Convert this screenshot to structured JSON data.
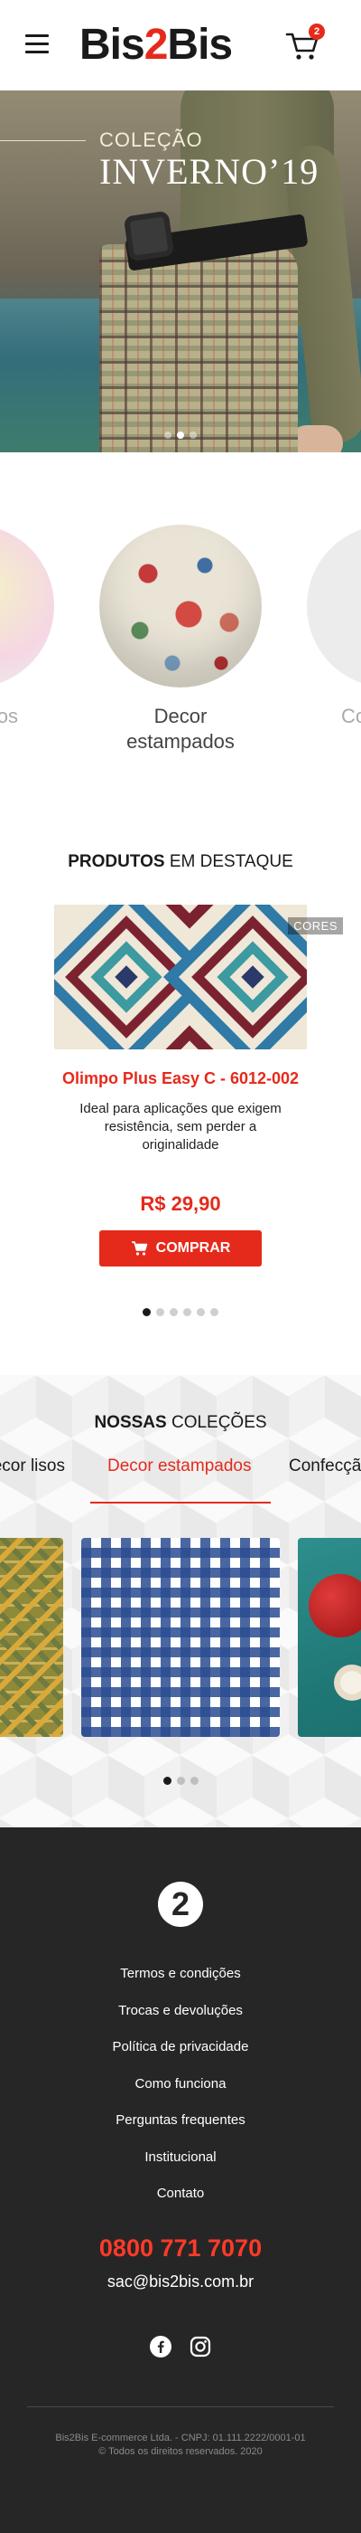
{
  "header": {
    "logo_part1": "Bis",
    "logo_part2": "2",
    "logo_part3": "Bis",
    "cart_count": "2",
    "menu_icon": "hamburger-menu-icon",
    "cart_icon": "shopping-cart-icon",
    "accent_color": "#e52a1b"
  },
  "hero": {
    "kicker": "COLEÇÃO",
    "title": "INVERNO’19",
    "slides": 3,
    "active_slide": 2
  },
  "categories": [
    {
      "label": "os"
    },
    {
      "label": "Decor estampados"
    },
    {
      "label": "Co"
    }
  ],
  "products": {
    "title_bold": "PRODUTOS",
    "title_rest": " EM DESTAQUE",
    "item": {
      "badge": "CORES",
      "name": "Olimpo Plus Easy C - 6012-002",
      "description": "Ideal para aplicações que exigem resistência, sem perder a originalidade",
      "price": "R$ 29,90",
      "button_label": "COMPRAR"
    },
    "pages": 6,
    "active_page": 1
  },
  "collections": {
    "title_bold": "NOSSAS",
    "title_rest": " COLEÇÕES",
    "tabs": [
      "Decor lisos",
      "Decor estampados",
      "Confecção"
    ],
    "active_tab": 1,
    "pages": 3,
    "active_page": 1
  },
  "footer": {
    "logo_text": "2",
    "links": [
      "Termos e condições",
      "Trocas e devoluções",
      "Política de privacidade",
      "Como funciona",
      "Perguntas frequentes",
      "Institucional",
      "Contato"
    ],
    "phone": "0800 771 7070",
    "email": "sac@bis2bis.com.br",
    "social_icons": [
      "facebook-icon",
      "instagram-icon"
    ],
    "legal_line1": "Bis2Bis E-commerce Ltda. - CNPJ: 01.111.2222/0001-01",
    "legal_line2": "© Todos os direitos reservados. 2020"
  }
}
